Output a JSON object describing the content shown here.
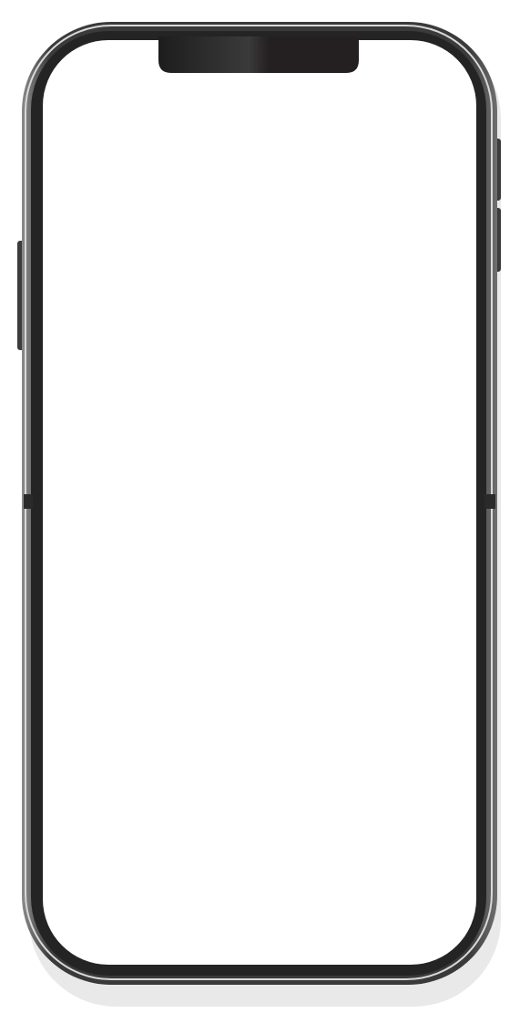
{
  "device": {
    "kind": "phone-mockup",
    "screen": {
      "state": "blank",
      "color": "#ffffff"
    },
    "colors": {
      "frame": "#3a3a3a",
      "bezel": "#242424",
      "notch": "#242022",
      "buttons": "#3c3c3c",
      "background": "#ffffff"
    }
  }
}
